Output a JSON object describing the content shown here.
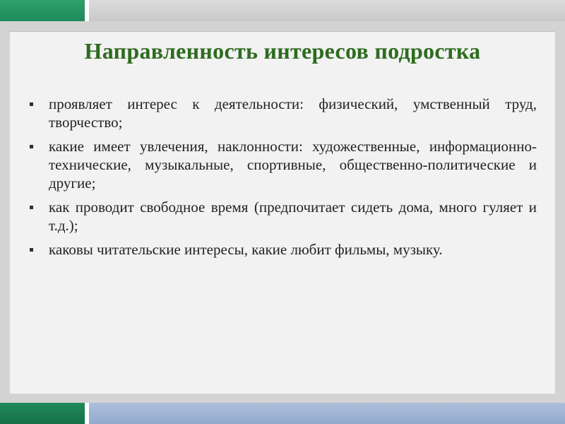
{
  "slide": {
    "title": "Направленность интересов подростка",
    "bullets": [
      {
        "text": "проявляет интерес к деятельности: физический, умственный труд, творчество;"
      },
      {
        "text": "какие имеет увлечения, наклонности: художественные, информационно-технические, музыкальные, спортивные, общественно-политические и другие;"
      },
      {
        "text": "как проводит свободное время (предпочитает сидеть дома, много гуляет и т.д.);"
      },
      {
        "text": "каковы читательские интересы, какие любит фильмы, музыку."
      }
    ]
  },
  "colors": {
    "title": "#2e6b1f",
    "accent_green": "#1f8a5a",
    "bottom_blue": "#93a9cf",
    "frame_gray": "#d3d3d3",
    "content_bg": "#f2f2f2"
  }
}
